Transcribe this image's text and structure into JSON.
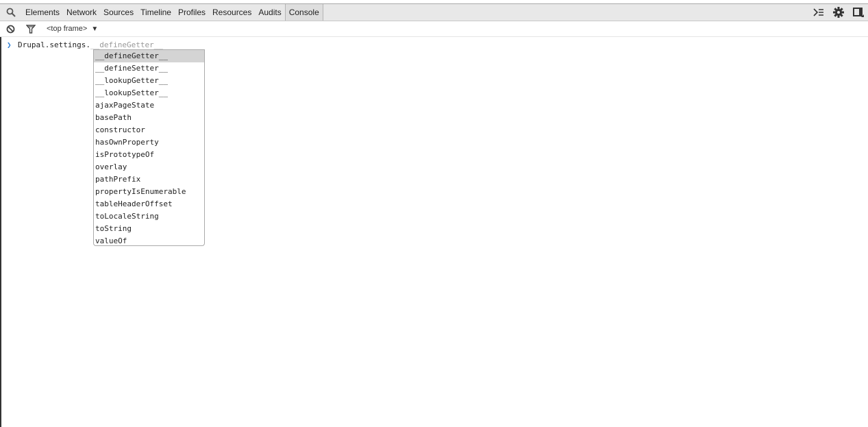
{
  "toolbar": {
    "search_icon": "magnifier-icon",
    "tabs": [
      {
        "label": "Elements"
      },
      {
        "label": "Network"
      },
      {
        "label": "Sources"
      },
      {
        "label": "Timeline"
      },
      {
        "label": "Profiles"
      },
      {
        "label": "Resources"
      },
      {
        "label": "Audits"
      },
      {
        "label": "Console",
        "selected": true
      }
    ],
    "right_icons": [
      "console-drawer-icon",
      "gear-icon",
      "dock-icon"
    ]
  },
  "subbar": {
    "clear_icon": "clear-console-icon",
    "filter_icon": "filter-icon",
    "frame_selector": "<top frame>"
  },
  "console": {
    "input_text": "Drupal.settings.",
    "ghost_completion": "__defineGetter__",
    "suggestions": [
      {
        "label": "__defineGetter__",
        "selected": true
      },
      {
        "label": "__defineSetter__"
      },
      {
        "label": "__lookupGetter__"
      },
      {
        "label": "__lookupSetter__"
      },
      {
        "label": "ajaxPageState"
      },
      {
        "label": "basePath"
      },
      {
        "label": "constructor"
      },
      {
        "label": "hasOwnProperty"
      },
      {
        "label": "isPrototypeOf"
      },
      {
        "label": "overlay"
      },
      {
        "label": "pathPrefix"
      },
      {
        "label": "propertyIsEnumerable"
      },
      {
        "label": "tableHeaderOffset"
      },
      {
        "label": "toLocaleString"
      },
      {
        "label": "toString"
      },
      {
        "label": "valueOf"
      }
    ]
  }
}
